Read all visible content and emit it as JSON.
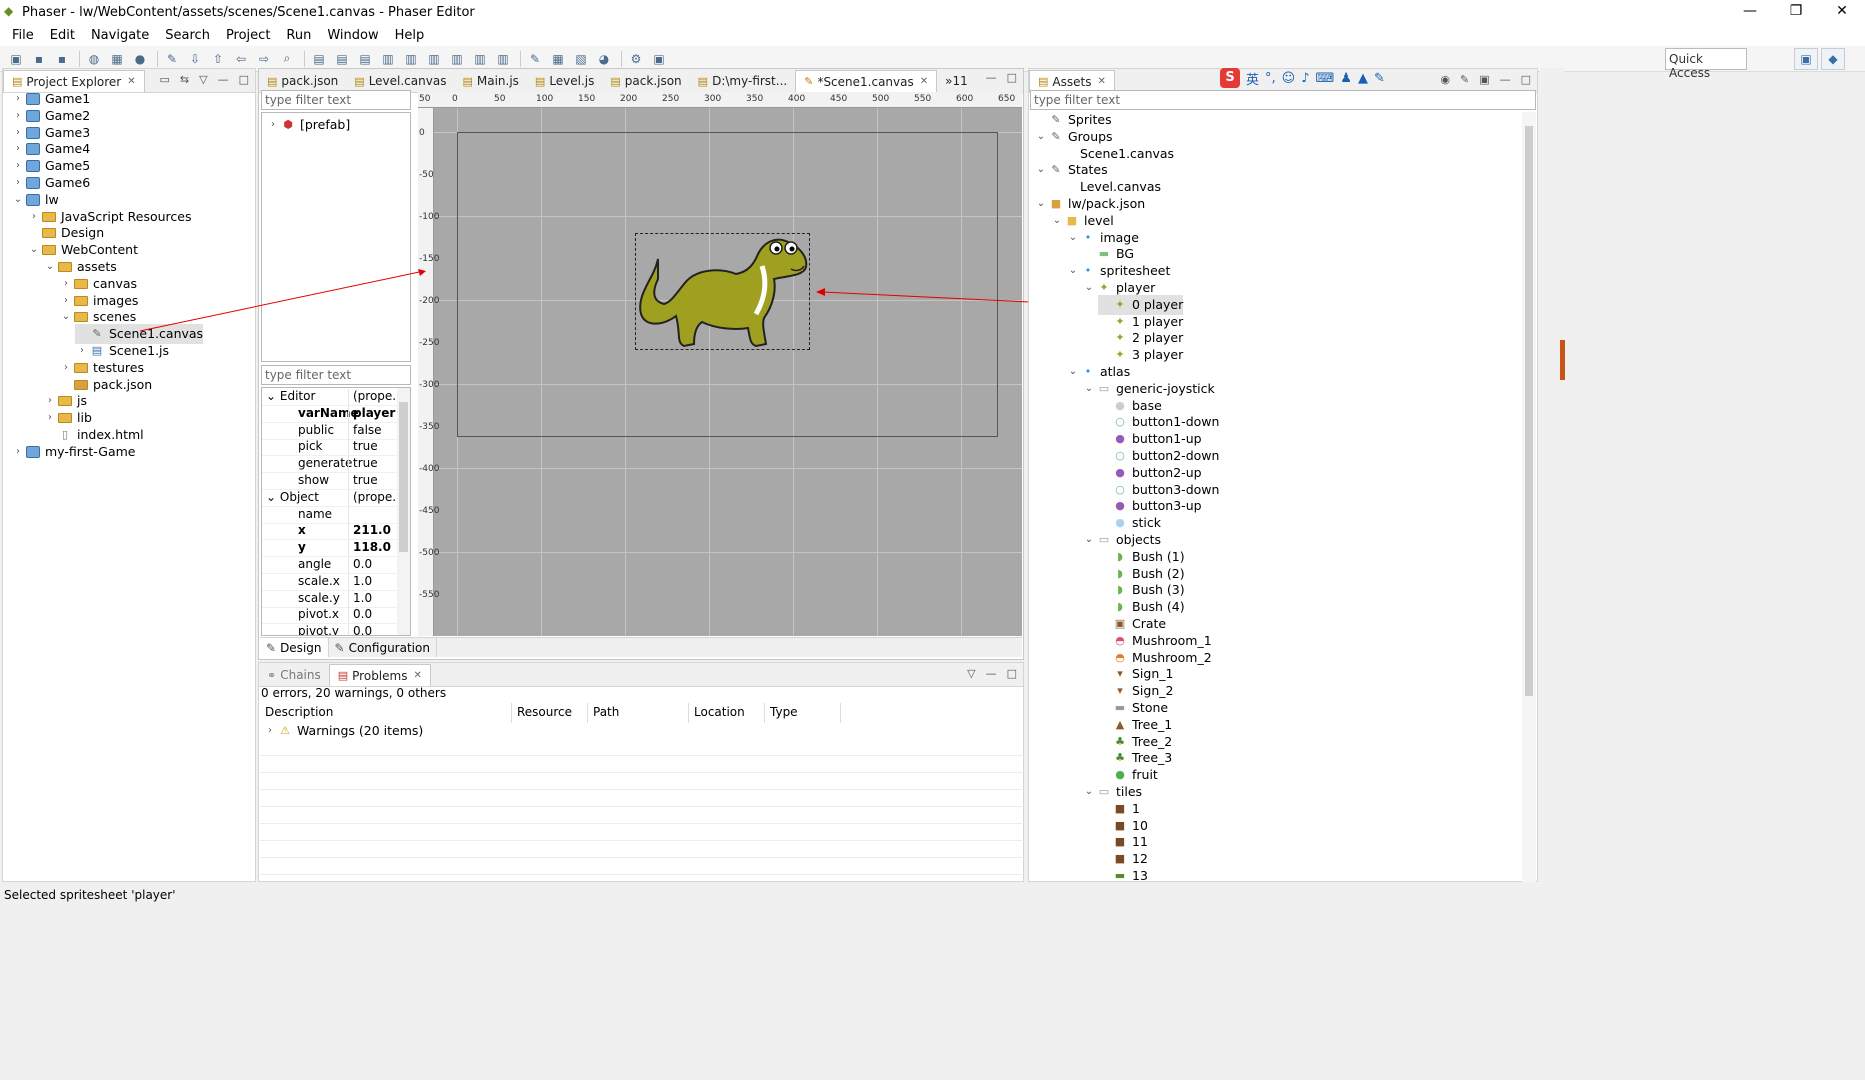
{
  "window": {
    "title": "Phaser - lw/WebContent/assets/scenes/Scene1.canvas - Phaser Editor",
    "min": "—",
    "max": "❐",
    "close": "✕"
  },
  "menu": [
    "File",
    "Edit",
    "Navigate",
    "Search",
    "Project",
    "Run",
    "Window",
    "Help"
  ],
  "quick_access": "Quick Access",
  "project_explorer": {
    "title": "Project Explorer",
    "items": [
      {
        "label": "Game1",
        "depth": 0,
        "arrow": "›",
        "icon": "project"
      },
      {
        "label": "Game2",
        "depth": 0,
        "arrow": "›",
        "icon": "project"
      },
      {
        "label": "Game3",
        "depth": 0,
        "arrow": "›",
        "icon": "project"
      },
      {
        "label": "Game4",
        "depth": 0,
        "arrow": "›",
        "icon": "project"
      },
      {
        "label": "Game5",
        "depth": 0,
        "arrow": "›",
        "icon": "project"
      },
      {
        "label": "Game6",
        "depth": 0,
        "arrow": "›",
        "icon": "project"
      },
      {
        "label": "lw",
        "depth": 0,
        "arrow": "⌄",
        "icon": "project"
      },
      {
        "label": "JavaScript Resources",
        "depth": 1,
        "arrow": "›",
        "icon": "folder"
      },
      {
        "label": "Design",
        "depth": 1,
        "arrow": "",
        "icon": "folder"
      },
      {
        "label": "WebContent",
        "depth": 1,
        "arrow": "⌄",
        "icon": "folder"
      },
      {
        "label": "assets",
        "depth": 2,
        "arrow": "⌄",
        "icon": "folder"
      },
      {
        "label": "canvas",
        "depth": 3,
        "arrow": "›",
        "icon": "folder"
      },
      {
        "label": "images",
        "depth": 3,
        "arrow": "›",
        "icon": "folder"
      },
      {
        "label": "scenes",
        "depth": 3,
        "arrow": "⌄",
        "icon": "folder"
      },
      {
        "label": "Scene1.canvas",
        "depth": 4,
        "arrow": "",
        "icon": "canvas",
        "selected": true
      },
      {
        "label": "Scene1.js",
        "depth": 4,
        "arrow": "›",
        "icon": "js"
      },
      {
        "label": "testures",
        "depth": 3,
        "arrow": "›",
        "icon": "folder"
      },
      {
        "label": "pack.json",
        "depth": 3,
        "arrow": "",
        "icon": "pack"
      },
      {
        "label": "js",
        "depth": 2,
        "arrow": "›",
        "icon": "folder"
      },
      {
        "label": "lib",
        "depth": 2,
        "arrow": "›",
        "icon": "folder"
      },
      {
        "label": "index.html",
        "depth": 2,
        "arrow": "",
        "icon": "file"
      },
      {
        "label": "my-first-Game",
        "depth": 0,
        "arrow": "›",
        "icon": "project"
      }
    ]
  },
  "editor_tabs": [
    {
      "label": "pack.json"
    },
    {
      "label": "Level.canvas"
    },
    {
      "label": "Main.js"
    },
    {
      "label": "Level.js"
    },
    {
      "label": "pack.json"
    },
    {
      "label": "D:\\my-first..."
    },
    {
      "label": "*Scene1.canvas",
      "active": true
    },
    {
      "label": "»11"
    }
  ],
  "outline": {
    "filter": "type filter text",
    "root": "[prefab]"
  },
  "properties": {
    "filter": "type filter text",
    "rows": [
      {
        "k": "Editor",
        "v": "(prope...",
        "group": true
      },
      {
        "k": "varName",
        "v": "player",
        "bold": true
      },
      {
        "k": "public",
        "v": "false"
      },
      {
        "k": "pick",
        "v": "true"
      },
      {
        "k": "generate",
        "v": "true"
      },
      {
        "k": "show",
        "v": "true"
      },
      {
        "k": "Object",
        "v": "(prope...",
        "group": true
      },
      {
        "k": "name",
        "v": ""
      },
      {
        "k": "x",
        "v": "211.0",
        "bold": true
      },
      {
        "k": "y",
        "v": "118.0",
        "bold": true
      },
      {
        "k": "angle",
        "v": "0.0"
      },
      {
        "k": "scale.x",
        "v": "1.0"
      },
      {
        "k": "scale.y",
        "v": "1.0"
      },
      {
        "k": "pivot.x",
        "v": "0.0"
      },
      {
        "k": "pivot.y",
        "v": "0.0"
      }
    ]
  },
  "ruler_top": [
    "50",
    "0",
    "50",
    "100",
    "150",
    "200",
    "250",
    "300",
    "350",
    "400",
    "450",
    "500",
    "550",
    "600",
    "650"
  ],
  "ruler_left": [
    "0",
    "-50",
    "-100",
    "-150",
    "-200",
    "-250",
    "-300",
    "-350",
    "-400",
    "-450",
    "-500",
    "-550"
  ],
  "editor_bottom_tabs": [
    "Design",
    "Configuration"
  ],
  "problems": {
    "tabs": [
      "Chains",
      "Problems"
    ],
    "summary": "0 errors, 20 warnings, 0 others",
    "columns": [
      "Description",
      "Resource",
      "Path",
      "Location",
      "Type"
    ],
    "rows": [
      {
        "desc": "Warnings (20 items)"
      }
    ]
  },
  "assets": {
    "title": "Assets",
    "filter": "type filter text",
    "items": [
      {
        "label": "Sprites",
        "depth": 0,
        "arrow": "",
        "icon": "canvas"
      },
      {
        "label": "Groups",
        "depth": 0,
        "arrow": "⌄",
        "icon": "canvas"
      },
      {
        "label": "Scene1.canvas",
        "depth": 2,
        "arrow": "",
        "icon": ""
      },
      {
        "label": "States",
        "depth": 0,
        "arrow": "⌄",
        "icon": "canvas"
      },
      {
        "label": "Level.canvas",
        "depth": 2,
        "arrow": "",
        "icon": ""
      },
      {
        "label": "lw/pack.json",
        "depth": 0,
        "arrow": "⌄",
        "icon": "pack"
      },
      {
        "label": "level",
        "depth": 1,
        "arrow": "⌄",
        "icon": "folder"
      },
      {
        "label": "image",
        "depth": 2,
        "arrow": "⌄",
        "icon": "dot"
      },
      {
        "label": "BG",
        "depth": 3,
        "arrow": "",
        "icon": "bg"
      },
      {
        "label": "spritesheet",
        "depth": 2,
        "arrow": "⌄",
        "icon": "dot"
      },
      {
        "label": "player",
        "depth": 3,
        "arrow": "⌄",
        "icon": "dino"
      },
      {
        "label": "0 player",
        "depth": 4,
        "arrow": "",
        "icon": "dino",
        "selected": true
      },
      {
        "label": "1 player",
        "depth": 4,
        "arrow": "",
        "icon": "dino"
      },
      {
        "label": "2 player",
        "depth": 4,
        "arrow": "",
        "icon": "dino"
      },
      {
        "label": "3 player",
        "depth": 4,
        "arrow": "",
        "icon": "dino"
      },
      {
        "label": "atlas",
        "depth": 2,
        "arrow": "⌄",
        "icon": "dot"
      },
      {
        "label": "generic-joystick",
        "depth": 3,
        "arrow": "⌄",
        "icon": "atlas"
      },
      {
        "label": "base",
        "depth": 4,
        "arrow": "",
        "icon": "gray"
      },
      {
        "label": "button1-down",
        "depth": 4,
        "arrow": "",
        "icon": "ring"
      },
      {
        "label": "button1-up",
        "depth": 4,
        "arrow": "",
        "icon": "purple"
      },
      {
        "label": "button2-down",
        "depth": 4,
        "arrow": "",
        "icon": "ring"
      },
      {
        "label": "button2-up",
        "depth": 4,
        "arrow": "",
        "icon": "purple"
      },
      {
        "label": "button3-down",
        "depth": 4,
        "arrow": "",
        "icon": "ring"
      },
      {
        "label": "button3-up",
        "depth": 4,
        "arrow": "",
        "icon": "purple"
      },
      {
        "label": "stick",
        "depth": 4,
        "arrow": "",
        "icon": "lightblue"
      },
      {
        "label": "objects",
        "depth": 3,
        "arrow": "⌄",
        "icon": "atlas"
      },
      {
        "label": "Bush (1)",
        "depth": 4,
        "arrow": "",
        "icon": "bush"
      },
      {
        "label": "Bush (2)",
        "depth": 4,
        "arrow": "",
        "icon": "bush"
      },
      {
        "label": "Bush (3)",
        "depth": 4,
        "arrow": "",
        "icon": "bush"
      },
      {
        "label": "Bush (4)",
        "depth": 4,
        "arrow": "",
        "icon": "bush"
      },
      {
        "label": "Crate",
        "depth": 4,
        "arrow": "",
        "icon": "crate"
      },
      {
        "label": "Mushroom_1",
        "depth": 4,
        "arrow": "",
        "icon": "mush1"
      },
      {
        "label": "Mushroom_2",
        "depth": 4,
        "arrow": "",
        "icon": "mush2"
      },
      {
        "label": "Sign_1",
        "depth": 4,
        "arrow": "",
        "icon": "sign"
      },
      {
        "label": "Sign_2",
        "depth": 4,
        "arrow": "",
        "icon": "sign"
      },
      {
        "label": "Stone",
        "depth": 4,
        "arrow": "",
        "icon": "stone"
      },
      {
        "label": "Tree_1",
        "depth": 4,
        "arrow": "",
        "icon": "tree1"
      },
      {
        "label": "Tree_2",
        "depth": 4,
        "arrow": "",
        "icon": "tree"
      },
      {
        "label": "Tree_3",
        "depth": 4,
        "arrow": "",
        "icon": "tree"
      },
      {
        "label": "fruit",
        "depth": 4,
        "arrow": "",
        "icon": "fruit"
      },
      {
        "label": "tiles",
        "depth": 3,
        "arrow": "⌄",
        "icon": "atlas"
      },
      {
        "label": "1",
        "depth": 4,
        "arrow": "",
        "icon": "tile"
      },
      {
        "label": "10",
        "depth": 4,
        "arrow": "",
        "icon": "tile"
      },
      {
        "label": "11",
        "depth": 4,
        "arrow": "",
        "icon": "tile"
      },
      {
        "label": "12",
        "depth": 4,
        "arrow": "",
        "icon": "tile"
      },
      {
        "label": "13",
        "depth": 4,
        "arrow": "",
        "icon": "tile2"
      }
    ]
  },
  "ime": {
    "s": "S",
    "eng": "英"
  },
  "status": "Selected spritesheet 'player'",
  "colors": {
    "canvas_bg": "#a8a8a8",
    "dino": "#a0a020",
    "annotation": "#e00000",
    "selection": "#e1e1e1"
  }
}
